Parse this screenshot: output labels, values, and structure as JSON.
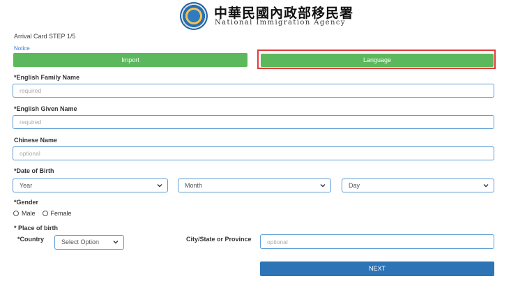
{
  "header": {
    "title_zh": "中華民國內政部移民署",
    "title_en": "National Immigration Agency"
  },
  "page": {
    "step_label": "Arrival Card STEP 1/5",
    "notice_link": "Notice"
  },
  "actions": {
    "import_label": "Import",
    "language_label": "Language",
    "next_label": "NEXT"
  },
  "fields": {
    "family_name": {
      "label": "*English Family Name",
      "placeholder": "required"
    },
    "given_name": {
      "label": "*English Given Name",
      "placeholder": "required"
    },
    "chinese_name": {
      "label": "Chinese Name",
      "placeholder": "optional"
    },
    "dob": {
      "label": "*Date of Birth",
      "year": "Year",
      "month": "Month",
      "day": "Day"
    },
    "gender": {
      "label": "*Gender",
      "options": [
        "Male",
        "Female"
      ]
    },
    "place_of_birth": {
      "label": "* Place of birth",
      "country_label": "*Country",
      "country_value": "Select Option",
      "city_label": "City/State or Province",
      "city_placeholder": "optional"
    }
  },
  "colors": {
    "green_button": "#5cb85c",
    "next_button": "#2d74b6",
    "highlight": "#e23a3a",
    "input_border": "#5b9bd5"
  }
}
